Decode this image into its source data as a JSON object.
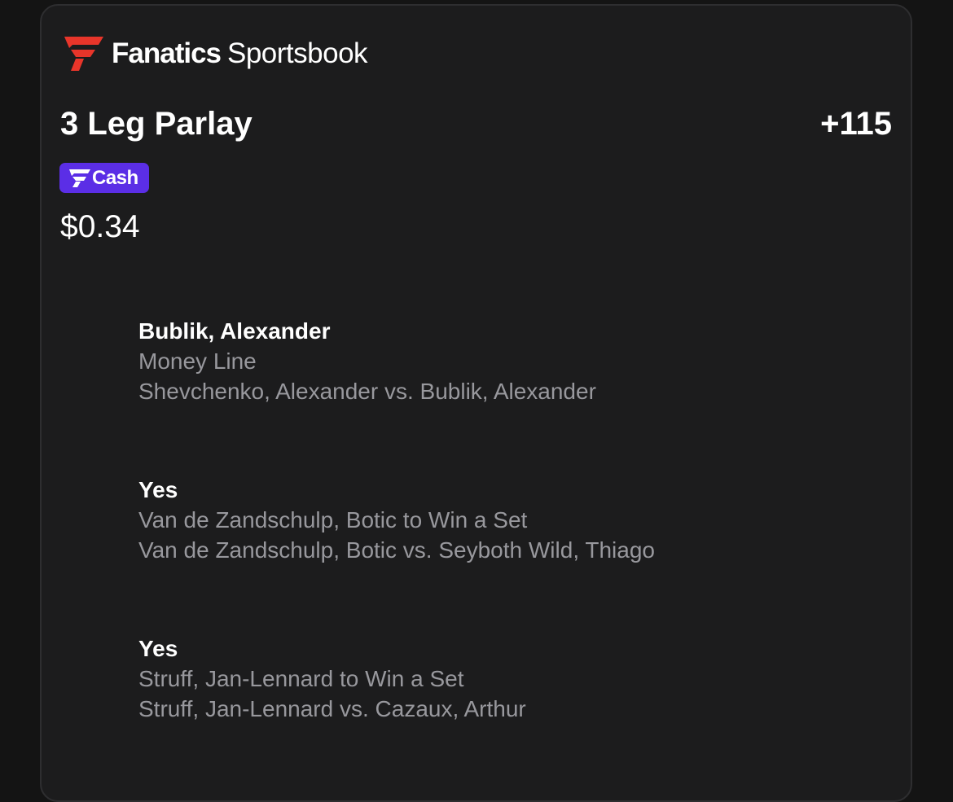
{
  "brand": {
    "name_bold": "Fanatics",
    "name_light": "Sportsbook",
    "logo_color": "#e8352a"
  },
  "bet": {
    "title": "3 Leg Parlay",
    "odds": "+115",
    "badge_label": "Cash",
    "badge_color": "#5b2ee6",
    "stake": "$0.34"
  },
  "legs": [
    {
      "pick": "Bublik, Alexander",
      "market": "Money Line",
      "event": "Shevchenko, Alexander vs. Bublik, Alexander"
    },
    {
      "pick": "Yes",
      "market": "Van de Zandschulp, Botic to Win a Set",
      "event": "Van de Zandschulp, Botic vs. Seyboth Wild, Thiago"
    },
    {
      "pick": "Yes",
      "market": "Struff, Jan-Lennard to Win a Set",
      "event": "Struff, Jan-Lennard vs. Cazaux, Arthur"
    }
  ]
}
